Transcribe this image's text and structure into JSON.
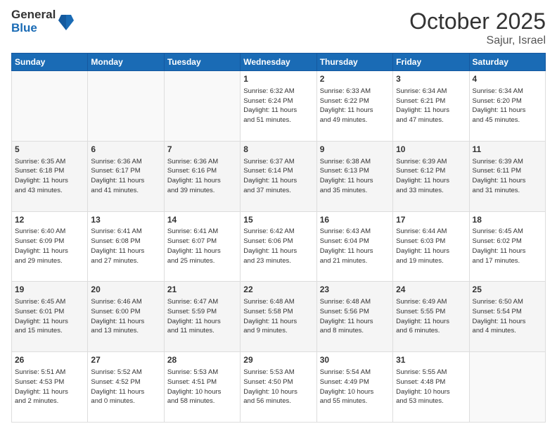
{
  "header": {
    "logo_general": "General",
    "logo_blue": "Blue",
    "month": "October 2025",
    "location": "Sajur, Israel"
  },
  "weekdays": [
    "Sunday",
    "Monday",
    "Tuesday",
    "Wednesday",
    "Thursday",
    "Friday",
    "Saturday"
  ],
  "weeks": [
    [
      {
        "day": "",
        "info": ""
      },
      {
        "day": "",
        "info": ""
      },
      {
        "day": "",
        "info": ""
      },
      {
        "day": "1",
        "info": "Sunrise: 6:32 AM\nSunset: 6:24 PM\nDaylight: 11 hours\nand 51 minutes."
      },
      {
        "day": "2",
        "info": "Sunrise: 6:33 AM\nSunset: 6:22 PM\nDaylight: 11 hours\nand 49 minutes."
      },
      {
        "day": "3",
        "info": "Sunrise: 6:34 AM\nSunset: 6:21 PM\nDaylight: 11 hours\nand 47 minutes."
      },
      {
        "day": "4",
        "info": "Sunrise: 6:34 AM\nSunset: 6:20 PM\nDaylight: 11 hours\nand 45 minutes."
      }
    ],
    [
      {
        "day": "5",
        "info": "Sunrise: 6:35 AM\nSunset: 6:18 PM\nDaylight: 11 hours\nand 43 minutes."
      },
      {
        "day": "6",
        "info": "Sunrise: 6:36 AM\nSunset: 6:17 PM\nDaylight: 11 hours\nand 41 minutes."
      },
      {
        "day": "7",
        "info": "Sunrise: 6:36 AM\nSunset: 6:16 PM\nDaylight: 11 hours\nand 39 minutes."
      },
      {
        "day": "8",
        "info": "Sunrise: 6:37 AM\nSunset: 6:14 PM\nDaylight: 11 hours\nand 37 minutes."
      },
      {
        "day": "9",
        "info": "Sunrise: 6:38 AM\nSunset: 6:13 PM\nDaylight: 11 hours\nand 35 minutes."
      },
      {
        "day": "10",
        "info": "Sunrise: 6:39 AM\nSunset: 6:12 PM\nDaylight: 11 hours\nand 33 minutes."
      },
      {
        "day": "11",
        "info": "Sunrise: 6:39 AM\nSunset: 6:11 PM\nDaylight: 11 hours\nand 31 minutes."
      }
    ],
    [
      {
        "day": "12",
        "info": "Sunrise: 6:40 AM\nSunset: 6:09 PM\nDaylight: 11 hours\nand 29 minutes."
      },
      {
        "day": "13",
        "info": "Sunrise: 6:41 AM\nSunset: 6:08 PM\nDaylight: 11 hours\nand 27 minutes."
      },
      {
        "day": "14",
        "info": "Sunrise: 6:41 AM\nSunset: 6:07 PM\nDaylight: 11 hours\nand 25 minutes."
      },
      {
        "day": "15",
        "info": "Sunrise: 6:42 AM\nSunset: 6:06 PM\nDaylight: 11 hours\nand 23 minutes."
      },
      {
        "day": "16",
        "info": "Sunrise: 6:43 AM\nSunset: 6:04 PM\nDaylight: 11 hours\nand 21 minutes."
      },
      {
        "day": "17",
        "info": "Sunrise: 6:44 AM\nSunset: 6:03 PM\nDaylight: 11 hours\nand 19 minutes."
      },
      {
        "day": "18",
        "info": "Sunrise: 6:45 AM\nSunset: 6:02 PM\nDaylight: 11 hours\nand 17 minutes."
      }
    ],
    [
      {
        "day": "19",
        "info": "Sunrise: 6:45 AM\nSunset: 6:01 PM\nDaylight: 11 hours\nand 15 minutes."
      },
      {
        "day": "20",
        "info": "Sunrise: 6:46 AM\nSunset: 6:00 PM\nDaylight: 11 hours\nand 13 minutes."
      },
      {
        "day": "21",
        "info": "Sunrise: 6:47 AM\nSunset: 5:59 PM\nDaylight: 11 hours\nand 11 minutes."
      },
      {
        "day": "22",
        "info": "Sunrise: 6:48 AM\nSunset: 5:58 PM\nDaylight: 11 hours\nand 9 minutes."
      },
      {
        "day": "23",
        "info": "Sunrise: 6:48 AM\nSunset: 5:56 PM\nDaylight: 11 hours\nand 8 minutes."
      },
      {
        "day": "24",
        "info": "Sunrise: 6:49 AM\nSunset: 5:55 PM\nDaylight: 11 hours\nand 6 minutes."
      },
      {
        "day": "25",
        "info": "Sunrise: 6:50 AM\nSunset: 5:54 PM\nDaylight: 11 hours\nand 4 minutes."
      }
    ],
    [
      {
        "day": "26",
        "info": "Sunrise: 5:51 AM\nSunset: 4:53 PM\nDaylight: 11 hours\nand 2 minutes."
      },
      {
        "day": "27",
        "info": "Sunrise: 5:52 AM\nSunset: 4:52 PM\nDaylight: 11 hours\nand 0 minutes."
      },
      {
        "day": "28",
        "info": "Sunrise: 5:53 AM\nSunset: 4:51 PM\nDaylight: 10 hours\nand 58 minutes."
      },
      {
        "day": "29",
        "info": "Sunrise: 5:53 AM\nSunset: 4:50 PM\nDaylight: 10 hours\nand 56 minutes."
      },
      {
        "day": "30",
        "info": "Sunrise: 5:54 AM\nSunset: 4:49 PM\nDaylight: 10 hours\nand 55 minutes."
      },
      {
        "day": "31",
        "info": "Sunrise: 5:55 AM\nSunset: 4:48 PM\nDaylight: 10 hours\nand 53 minutes."
      },
      {
        "day": "",
        "info": ""
      }
    ]
  ]
}
